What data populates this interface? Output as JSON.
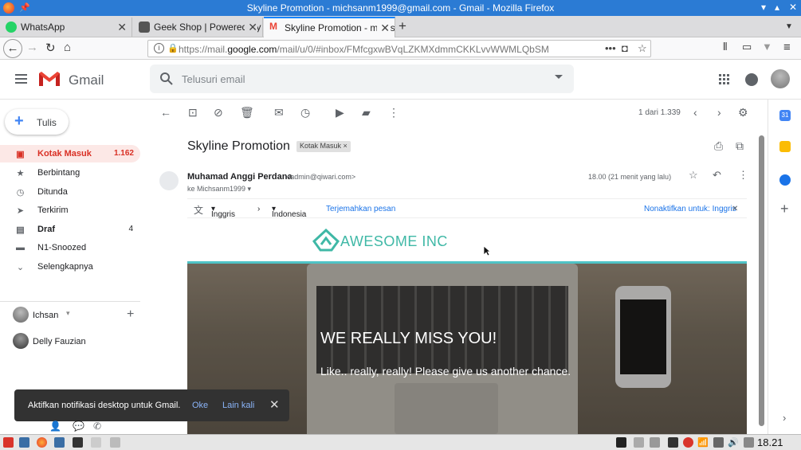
{
  "window": {
    "title": "Skyline Promotion - michsanm1999@gmail.com - Gmail - Mozilla Firefox"
  },
  "tabs": [
    {
      "label": "WhatsApp",
      "color": "#25d366"
    },
    {
      "label": "Geek Shop | Powered By T",
      "color": "#555555"
    },
    {
      "label": "Skyline Promotion - michsa",
      "color": "#ea4335"
    }
  ],
  "nav": {
    "url_prefix": "https://mail.",
    "url_domain": "google.com",
    "url_rest": "/mail/u/0/#inbox/FMfcgxwBVqLZKMXdmmCKKLvvWWMLQbSM"
  },
  "gmail": {
    "product": "Gmail",
    "search_placeholder": "Telusuri email",
    "compose": "Tulis",
    "folders": [
      {
        "label": "Kotak Masuk",
        "count": "1.162",
        "icon": "inbox-icon"
      },
      {
        "label": "Berbintang",
        "count": "",
        "icon": "star-icon"
      },
      {
        "label": "Ditunda",
        "count": "",
        "icon": "clock-icon"
      },
      {
        "label": "Terkirim",
        "count": "",
        "icon": "send-icon"
      },
      {
        "label": "Draf",
        "count": "4",
        "icon": "draft-icon"
      },
      {
        "label": "N1-Snoozed",
        "count": "",
        "icon": "label-icon"
      },
      {
        "label": "Selengkapnya",
        "count": "",
        "icon": "chevron-down-icon"
      }
    ],
    "hangouts": [
      {
        "name": "Ichsan"
      },
      {
        "name": "Delly Fauzian"
      }
    ],
    "pager": "1 dari 1.339"
  },
  "message": {
    "subject": "Skyline Promotion",
    "label_chip": "Kotak Masuk ×",
    "sender_name": "Muhamad Anggi Perdana",
    "sender_email": "<admin@qiwari.com>",
    "recipient": "ke Michsanm1999",
    "time": "18.00 (21 menit yang lalu)"
  },
  "translate": {
    "from": "Inggris",
    "to": "Indonesia",
    "action": "Terjemahkan pesan",
    "disable": "Nonaktifkan untuk: Inggris"
  },
  "body": {
    "brand": "AWESOME INC",
    "brand_color": "#3fb8a6",
    "hero_title": "WE REALLY MISS YOU!",
    "hero_sub": "Like.. really, really! Please give us another chance."
  },
  "snackbar": {
    "message": "Aktifkan notifikasi desktop untuk Gmail.",
    "ok": "Oke",
    "later": "Lain kali"
  },
  "taskbar": {
    "clock": "18.21"
  }
}
